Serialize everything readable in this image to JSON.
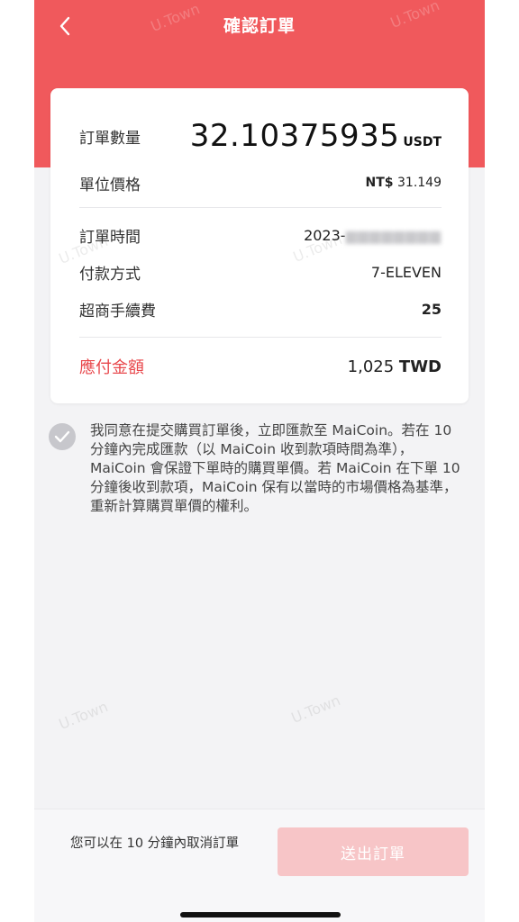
{
  "header": {
    "title": "確認訂單"
  },
  "order": {
    "quantity_label": "訂單數量",
    "quantity_value": "32.10375935",
    "quantity_unit": "USDT",
    "unit_price_label": "單位價格",
    "unit_price_currency": "NT$",
    "unit_price_value": "31.149",
    "time_label": "訂單時間",
    "time_value": "2023-",
    "payment_label": "付款方式",
    "payment_value": "7-ELEVEN",
    "fee_label": "超商手續費",
    "fee_value": "25",
    "total_label": "應付金額",
    "total_value": "1,025",
    "total_unit": "TWD"
  },
  "agreement": {
    "text": "我同意在提交購買訂單後，立即匯款至 MaiCoin。若在 10 分鐘內完成匯款（以 MaiCoin 收到款項時間為準），MaiCoin 會保證下單時的購買單價。若 MaiCoin 在下單 10 分鐘後收到款項，MaiCoin 保有以當時的市場價格為基準，重新計算購買單價的權利。"
  },
  "footer": {
    "cancel_hint": "您可以在 10 分鐘內取消訂單",
    "submit_label": "送出訂單"
  },
  "watermark": "U.Town",
  "colors": {
    "brand_red": "#f0595c",
    "total_label_red": "#e8474b",
    "submit_disabled": "#f7c5c7"
  }
}
